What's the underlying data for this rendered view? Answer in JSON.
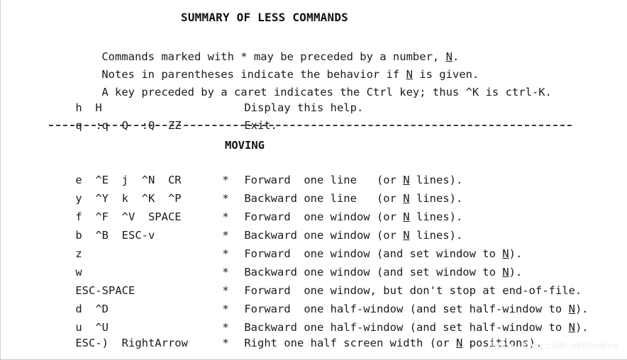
{
  "document": {
    "title": "SUMMARY OF LESS COMMANDS",
    "intro_lines": [
      "Commands marked with * may be preceded by a number, N.",
      "Notes in parentheses indicate the behavior if N is given.",
      "A key preceded by a caret indicates the Ctrl key; thus ^K is ctrl-K."
    ],
    "intro_parts": [
      {
        "before": "Commands marked with * may be preceded by a number, ",
        "var": "N",
        "after": "."
      },
      {
        "before": "Notes in parentheses indicate the behavior if ",
        "var": "N",
        "after": " is given."
      },
      {
        "before": "A key preceded by a caret indicates the Ctrl key; thus ^K is ctrl-K.",
        "var": "",
        "after": ""
      }
    ],
    "separator": "---------------------------------------------------------------------",
    "section_header": "MOVING",
    "watermark": "https://blog.csdn.net/mukes"
  },
  "general_commands": [
    {
      "keys": "h  H",
      "star": "",
      "desc_before": "Display this help.",
      "var": "",
      "desc_after": ""
    },
    {
      "keys": "q  :q  Q  :Q  ZZ",
      "star": "",
      "desc_before": "Exit.",
      "var": "",
      "desc_after": ""
    }
  ],
  "moving_commands": [
    {
      "keys": "e  ^E  j  ^N  CR",
      "star": "*",
      "desc_before": "Forward  one line   (or ",
      "var": "N",
      "desc_after": " lines)."
    },
    {
      "keys": "y  ^Y  k  ^K  ^P",
      "star": "*",
      "desc_before": "Backward one line   (or ",
      "var": "N",
      "desc_after": " lines)."
    },
    {
      "keys": "f  ^F  ^V  SPACE",
      "star": "*",
      "desc_before": "Forward  one window (or ",
      "var": "N",
      "desc_after": " lines)."
    },
    {
      "keys": "b  ^B  ESC-v",
      "star": "*",
      "desc_before": "Backward one window (or ",
      "var": "N",
      "desc_after": " lines)."
    },
    {
      "keys": "z",
      "star": "*",
      "desc_before": "Forward  one window (and set window to ",
      "var": "N",
      "desc_after": ")."
    },
    {
      "keys": "w",
      "star": "*",
      "desc_before": "Backward one window (and set window to ",
      "var": "N",
      "desc_after": ")."
    },
    {
      "keys": "ESC-SPACE",
      "star": "*",
      "desc_before": "Forward  one window, but don't stop at end-of-file.",
      "var": "",
      "desc_after": ""
    },
    {
      "keys": "d  ^D",
      "star": "*",
      "desc_before": "Forward  one half-window (and set half-window to ",
      "var": "N",
      "desc_after": ")."
    },
    {
      "keys": "u  ^U",
      "star": "*",
      "desc_before": "Backward one half-window (and set half-window to ",
      "var": "N",
      "desc_after": ")."
    },
    {
      "keys": "ESC-)  RightArrow",
      "star": "*",
      "desc_before": "Right one half screen width (or ",
      "var": "N",
      "desc_after": " positions)."
    }
  ],
  "layout": {
    "row_tops_general": [
      121,
      146
    ],
    "row_tops_moving": [
      223,
      249,
      275,
      301,
      327,
      353,
      379,
      405,
      431,
      453
    ]
  },
  "colors": {
    "background": "#ffffff",
    "text": "#1b1b1b",
    "separator": "#3a3a3a",
    "watermark": "#eceef0",
    "border": "#d0d0d0"
  }
}
